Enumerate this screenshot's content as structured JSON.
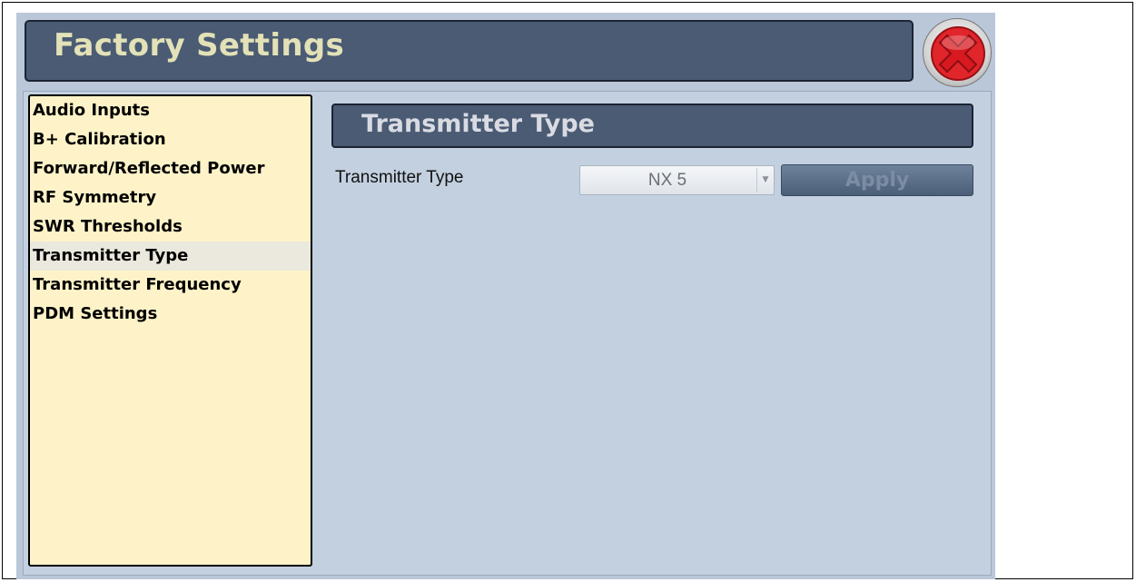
{
  "window": {
    "title": "Factory Settings",
    "close_icon": "close-icon"
  },
  "sidebar": {
    "items": [
      {
        "label": "Audio Inputs",
        "selected": false
      },
      {
        "label": "B+ Calibration",
        "selected": false
      },
      {
        "label": "Forward/Reflected Power",
        "selected": false
      },
      {
        "label": "RF Symmetry",
        "selected": false
      },
      {
        "label": "SWR Thresholds",
        "selected": false
      },
      {
        "label": "Transmitter Type",
        "selected": true
      },
      {
        "label": "Transmitter Frequency",
        "selected": false
      },
      {
        "label": "PDM Settings",
        "selected": false
      }
    ]
  },
  "panel": {
    "title": "Transmitter Type",
    "field_label": "Transmitter Type",
    "select_value": "NX 5",
    "apply_label": "Apply"
  },
  "colors": {
    "title_bar": "#4a5b73",
    "title_text": "#e3e1b7",
    "sidebar_bg": "#fef3c8",
    "panel_bg": "#c3d0e0",
    "close_red": "#e0262b"
  }
}
